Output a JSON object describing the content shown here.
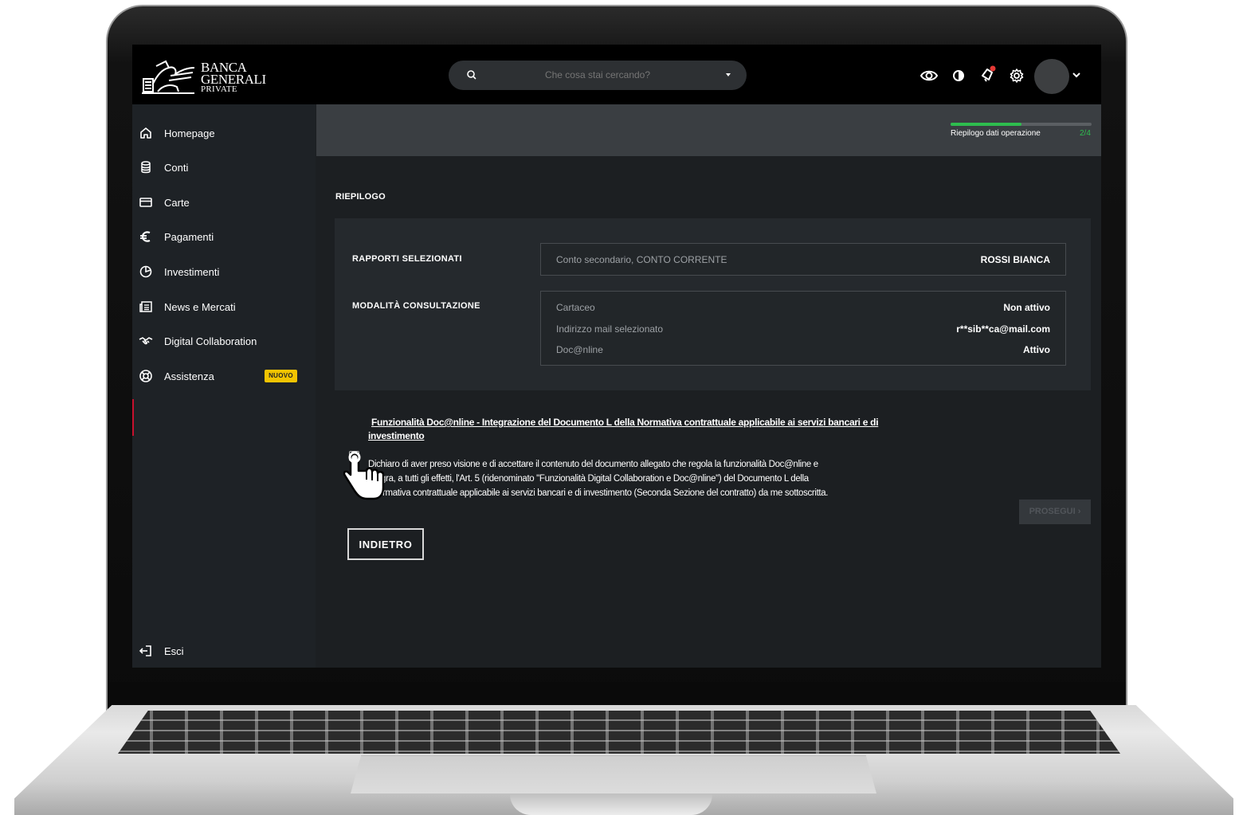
{
  "brand": {
    "line1": "BANCA",
    "line2": "GENERALI",
    "line3": "PRIVATE"
  },
  "search": {
    "placeholder": "Che cosa stai cercando?"
  },
  "topbar_icons": [
    "eye-icon",
    "contrast-icon",
    "notifications-icon",
    "settings-icon"
  ],
  "sidebar": {
    "items": [
      {
        "label": "Homepage",
        "icon": "home-icon"
      },
      {
        "label": "Conti",
        "icon": "accounts-icon"
      },
      {
        "label": "Carte",
        "icon": "card-icon"
      },
      {
        "label": "Pagamenti",
        "icon": "euro-icon"
      },
      {
        "label": "Investimenti",
        "icon": "pie-chart-icon"
      },
      {
        "label": "News e Mercati",
        "icon": "news-icon"
      },
      {
        "label": "Digital Collaboration",
        "icon": "handshake-icon"
      },
      {
        "label": "Assistenza",
        "icon": "lifebuoy-icon",
        "badge": "NUOVO"
      }
    ],
    "logout": "Esci"
  },
  "progress": {
    "label": "Riepilogo dati operazione",
    "step": "2/4",
    "fraction": 0.5,
    "color": "#2ebd4e"
  },
  "summary": {
    "title": "RIEPILOGO",
    "rapporti": {
      "label": "RAPPORTI SELEZIONATI",
      "account": "Conto secondario, CONTO CORRENTE",
      "holder": "ROSSI BIANCA"
    },
    "modalita": {
      "label": "MODALITÀ CONSULTAZIONE",
      "rows": [
        {
          "key": "Cartaceo",
          "value": "Non attivo"
        },
        {
          "key": "Indirizzo mail selezionato",
          "value": "r**sib**ca@mail.com"
        },
        {
          "key": "Doc@nline",
          "value": "Attivo"
        }
      ]
    }
  },
  "document": {
    "link_line1": "Funzionalità Doc@nline - Integrazione del Documento L della Normativa contrattuale applicabile ai servizi bancari e di",
    "link_line2": "investimento",
    "consent_line1": "Dichiaro di aver preso visione e di accettare il contenuto del documento allegato che regola la funzionalità Doc@nline e",
    "consent_line2": "egra, a tutti gli effetti, l'Art. 5 (ridenominato \"Funzionalità Digital Collaboration e Doc@nline\") del Documento L della",
    "consent_line3": "rmativa contrattuale applicabile ai servizi bancari e di investimento (Seconda Sezione del contratto) da me sottoscritta."
  },
  "buttons": {
    "prosegui": "PROSEGUI ›",
    "indietro": "INDIETRO"
  }
}
